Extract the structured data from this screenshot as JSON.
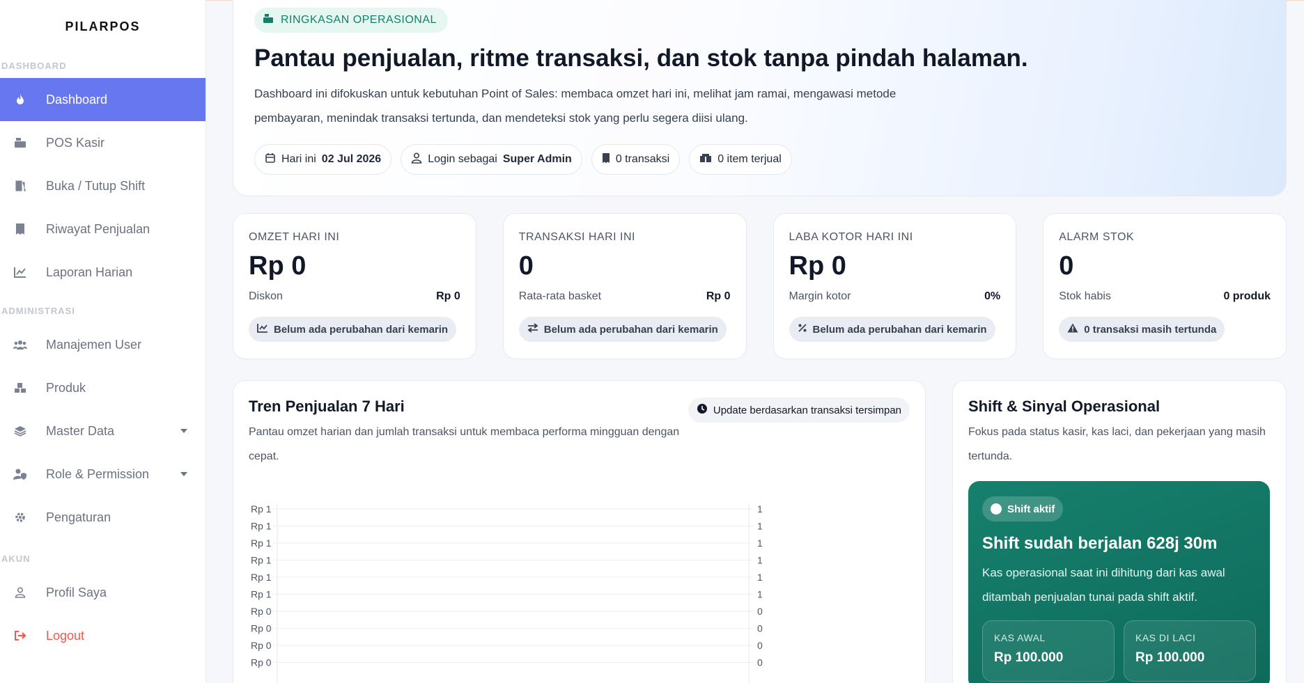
{
  "sidebar": {
    "brand": "PILARPOS",
    "sections": {
      "dashboard": "DASHBOARD",
      "administrasi": "ADMINISTRASI",
      "akun": "AKUN"
    },
    "items": [
      {
        "label": "Dashboard",
        "icon": "fire-icon",
        "active": true
      },
      {
        "label": "POS Kasir",
        "icon": "cash-register-icon"
      },
      {
        "label": "Buka / Tutup Shift",
        "icon": "door-open-icon"
      },
      {
        "label": "Riwayat Penjualan",
        "icon": "receipt-icon"
      },
      {
        "label": "Laporan Harian",
        "icon": "chart-line-icon"
      },
      {
        "label": "Manajemen User",
        "icon": "users-icon"
      },
      {
        "label": "Produk",
        "icon": "boxes-icon"
      },
      {
        "label": "Master Data",
        "icon": "layers-icon"
      },
      {
        "label": "Role & Permission",
        "icon": "user-shield-icon"
      },
      {
        "label": "Pengaturan",
        "icon": "gear-icon"
      },
      {
        "label": "Profil Saya",
        "icon": "user-icon"
      },
      {
        "label": "Logout",
        "icon": "sign-out-icon"
      }
    ]
  },
  "hero": {
    "tag": "RINGKASAN OPERASIONAL",
    "title": "Pantau penjualan, ritme transaksi, dan stok tanpa pindah halaman.",
    "description": "Dashboard ini difokuskan untuk kebutuhan Point of Sales: membaca omzet hari ini, melihat jam ramai, mengawasi metode pembayaran, menindak transaksi tertunda, dan mendeteksi stok yang perlu segera diisi ulang.",
    "chips": {
      "date_label": "Hari ini",
      "date_value": "02 Jul 2026",
      "login_label": "Login sebagai",
      "login_value": "Super Admin",
      "transactions": "0 transaksi",
      "items_sold": "0 item terjual"
    }
  },
  "stats": [
    {
      "label": "OMZET HARI INI",
      "value": "Rp 0",
      "sub_label": "Diskon",
      "sub_value": "Rp 0",
      "badge": "Belum ada perubahan dari kemarin",
      "badge_icon": "trend-icon"
    },
    {
      "label": "TRANSAKSI HARI INI",
      "value": "0",
      "sub_label": "Rata-rata basket",
      "sub_value": "Rp 0",
      "badge": "Belum ada perubahan dari kemarin",
      "badge_icon": "exchange-icon"
    },
    {
      "label": "LABA KOTOR HARI INI",
      "value": "Rp 0",
      "sub_label": "Margin kotor",
      "sub_value": "0%",
      "badge": "Belum ada perubahan dari kemarin",
      "badge_icon": "percent-icon"
    },
    {
      "label": "ALARM STOK",
      "value": "0",
      "sub_label": "Stok habis",
      "sub_value": "0 produk",
      "badge": "0 transaksi masih tertunda",
      "badge_icon": "warning-icon"
    }
  ],
  "trend": {
    "title": "Tren Penjualan 7 Hari",
    "subtitle": "Pantau omzet harian dan jumlah transaksi untuk membaca performa mingguan dengan cepat.",
    "update_badge": "Update berdasarkan transaksi tersimpan"
  },
  "chart_data": {
    "type": "line",
    "left_ticks": [
      "Rp 1",
      "Rp 1",
      "Rp 1",
      "Rp 1",
      "Rp 1",
      "Rp 1",
      "Rp 0",
      "Rp 0",
      "Rp 0",
      "Rp 0"
    ],
    "right_ticks": [
      "1",
      "1",
      "1",
      "1",
      "1",
      "1",
      "0",
      "0",
      "0",
      "0"
    ],
    "grid": true
  },
  "shift": {
    "title": "Shift & Sinyal Operasional",
    "subtitle": "Fokus pada status kasir, kas laci, dan pekerjaan yang masih tertunda.",
    "status": "Shift aktif",
    "headline": "Shift sudah berjalan 628j 30m",
    "description": "Kas operasional saat ini dihitung dari kas awal ditambah penjualan tunai pada shift aktif.",
    "kas_awal_label": "KAS AWAL",
    "kas_awal_value": "Rp 100.000",
    "kas_laci_label": "KAS DI LACI",
    "kas_laci_value": "Rp 100.000"
  },
  "colors": {
    "primary": "#6777ef",
    "accent_green": "#12806a",
    "danger": "#fc544b"
  }
}
